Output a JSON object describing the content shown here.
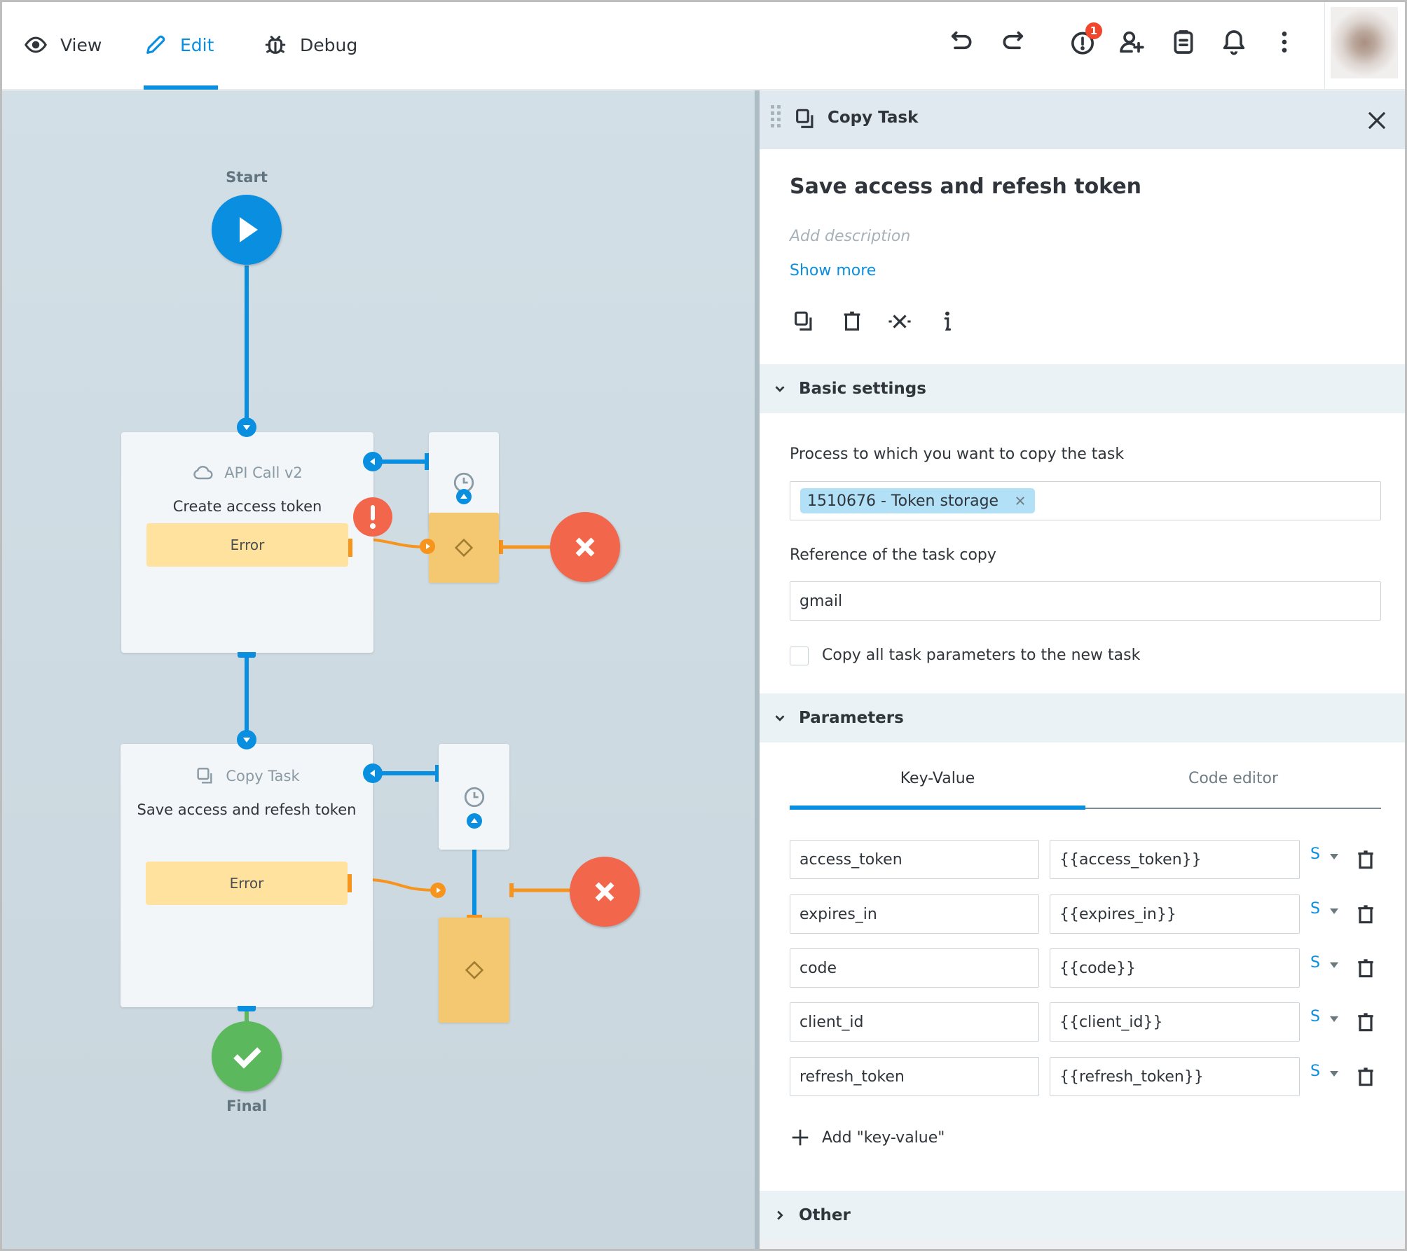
{
  "header": {
    "modes": [
      {
        "label": "View",
        "icon": "eye-icon",
        "active": false
      },
      {
        "label": "Edit",
        "icon": "pencil-icon",
        "active": true
      },
      {
        "label": "Debug",
        "icon": "bug-icon",
        "active": false
      }
    ],
    "actions": [
      {
        "name": "undo",
        "icon": "undo-icon"
      },
      {
        "name": "redo",
        "icon": "redo-icon"
      },
      {
        "name": "alerts",
        "icon": "alert-circle-icon",
        "badge": "1"
      },
      {
        "name": "add-user",
        "icon": "user-plus-icon"
      },
      {
        "name": "clipboard",
        "icon": "clipboard-icon"
      },
      {
        "name": "notifications",
        "icon": "bell-icon"
      },
      {
        "name": "more",
        "icon": "more-vertical-icon"
      }
    ],
    "accent_color": "#0a8fe0"
  },
  "diagram": {
    "start_label": "Start",
    "final_label": "Final",
    "tasks": [
      {
        "type": "API Call v2",
        "type_icon": "cloud-icon",
        "name": "Create access token",
        "error_label": "Error",
        "has_warning": true
      },
      {
        "type": "Copy Task",
        "type_icon": "copy-icon",
        "name": "Save access and refesh token",
        "error_label": "Error",
        "has_warning": false
      }
    ],
    "colors": {
      "start": "#0a8fe0",
      "final": "#5cb85c",
      "error_end": "#f2664c",
      "error_bar": "#ffe29d",
      "condition": "#f3c871",
      "connector_orange": "#f7941d"
    }
  },
  "panel": {
    "header_title": "Copy Task",
    "task_title": "Save access and refesh token",
    "description_placeholder": "Add description",
    "show_more": "Show more",
    "actions": [
      "copy-icon",
      "trash-icon",
      "disconnect-icon",
      "info-icon"
    ],
    "basic_settings": {
      "title": "Basic settings",
      "expanded": true,
      "process_label": "Process to which you want to copy the task",
      "process_chip": "1510676 - Token storage",
      "reference_label": "Reference of the task copy",
      "reference_value": "gmail",
      "copy_all_label": "Copy all task parameters to the new task",
      "copy_all_checked": false
    },
    "parameters": {
      "title": "Parameters",
      "expanded": true,
      "tabs": [
        {
          "label": "Key-Value",
          "active": true
        },
        {
          "label": "Code editor",
          "active": false
        }
      ],
      "rows": [
        {
          "key": "access_token",
          "value": "{{access_token}}",
          "type": "S"
        },
        {
          "key": "expires_in",
          "value": "{{expires_in}}",
          "type": "S"
        },
        {
          "key": "code",
          "value": "{{code}}",
          "type": "S"
        },
        {
          "key": "client_id",
          "value": "{{client_id}}",
          "type": "S"
        },
        {
          "key": "refresh_token",
          "value": "{{refresh_token}}",
          "type": "S"
        }
      ],
      "add_label": "Add \"key-value\""
    },
    "other": {
      "title": "Other",
      "expanded": false
    }
  }
}
